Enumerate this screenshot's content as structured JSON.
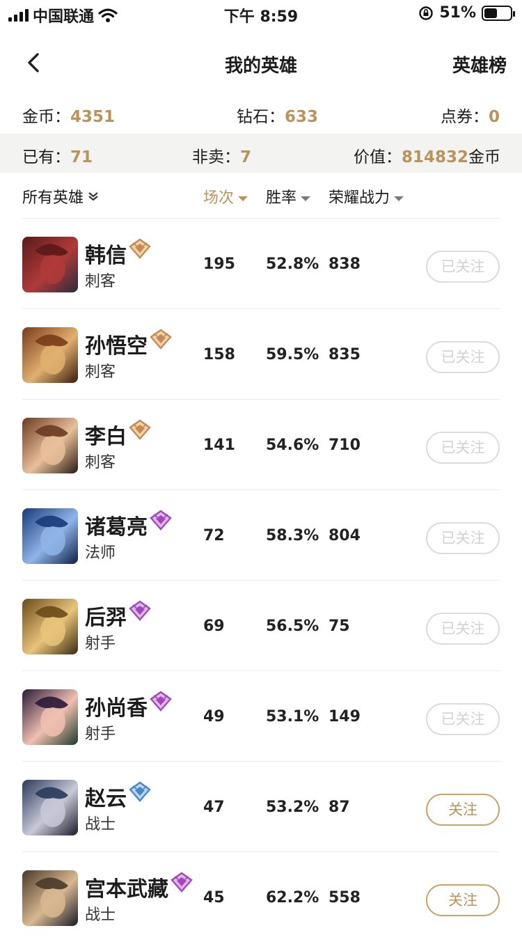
{
  "status": {
    "carrier": "中国联通",
    "time": "下午 8:59",
    "battery": "51%",
    "battery_level": 0.51
  },
  "nav": {
    "title": "我的英雄",
    "right": "英雄榜"
  },
  "wallet": {
    "gold_label": "金币：",
    "gold": "4351",
    "diamond_label": "钻石：",
    "diamond": "633",
    "coupon_label": "点券：",
    "coupon": "0"
  },
  "summary": {
    "owned_label": "已有：",
    "owned": "71",
    "notsale_label": "非卖：",
    "notsale": "7",
    "value_label": "价值：",
    "value": "814832",
    "value_unit": "金币"
  },
  "filters": {
    "all": "所有英雄",
    "matches": "场次",
    "winrate": "胜率",
    "power": "荣耀战力"
  },
  "heroes": [
    {
      "name": "韩信",
      "role": "刺客",
      "matches": "195",
      "winrate": "52.8%",
      "power": "838",
      "follow": "已关注",
      "followed": true,
      "badge": "orange",
      "colors": [
        "#5a1a1a",
        "#b03a3a",
        "#2b2b3a"
      ]
    },
    {
      "name": "孙悟空",
      "role": "刺客",
      "matches": "158",
      "winrate": "59.5%",
      "power": "835",
      "follow": "已关注",
      "followed": true,
      "badge": "orange",
      "colors": [
        "#7a3b1a",
        "#e0b070",
        "#3a1c0c"
      ]
    },
    {
      "name": "李白",
      "role": "刺客",
      "matches": "141",
      "winrate": "54.6%",
      "power": "710",
      "follow": "已关注",
      "followed": true,
      "badge": "orange",
      "colors": [
        "#6a3a22",
        "#e8c09a",
        "#2a1a12"
      ]
    },
    {
      "name": "诸葛亮",
      "role": "法师",
      "matches": "72",
      "winrate": "58.3%",
      "power": "804",
      "follow": "已关注",
      "followed": true,
      "badge": "purple",
      "colors": [
        "#1a3a7a",
        "#8fb4e8",
        "#0e1e44"
      ]
    },
    {
      "name": "后羿",
      "role": "射手",
      "matches": "69",
      "winrate": "56.5%",
      "power": "75",
      "follow": "已关注",
      "followed": true,
      "badge": "purple",
      "colors": [
        "#6a4a1a",
        "#e8c47a",
        "#3a2a10"
      ]
    },
    {
      "name": "孙尚香",
      "role": "射手",
      "matches": "49",
      "winrate": "53.1%",
      "power": "149",
      "follow": "已关注",
      "followed": true,
      "badge": "purple",
      "colors": [
        "#2a1a3a",
        "#f0c0b0",
        "#1a3a2a"
      ]
    },
    {
      "name": "赵云",
      "role": "战士",
      "matches": "47",
      "winrate": "53.2%",
      "power": "87",
      "follow": "关注",
      "followed": false,
      "badge": "blue",
      "colors": [
        "#2a3a5a",
        "#c8c8d8",
        "#1a1a2a"
      ]
    },
    {
      "name": "宫本武藏",
      "role": "战士",
      "matches": "45",
      "winrate": "62.2%",
      "power": "558",
      "follow": "关注",
      "followed": false,
      "badge": "purple",
      "colors": [
        "#4a3a2a",
        "#d8b890",
        "#1a1a2a"
      ]
    }
  ]
}
